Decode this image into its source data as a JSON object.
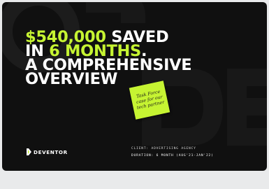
{
  "slide": {
    "headline": {
      "line1_accent": "$540,000",
      "line1_rest": " SAVED",
      "line2_prefix": "IN ",
      "line2_accent": "6 MONTHS",
      "line2_suffix": ".",
      "line3": "A COMPREHENSIVE",
      "line4": "OVERVIEW"
    },
    "sticky_note": "Task Force\ncase for our\ntech partner",
    "logo": {
      "wordmark": "DEVENTOR",
      "icon": "deventor-logo-icon"
    },
    "client": "CLIENT: ADVERTISING AGENCY",
    "duration": "DURATION: 6 MONTH (AUG'21-JAN'22)",
    "colors": {
      "background": "#101010",
      "accent": "#c6f432",
      "text": "#ffffff"
    }
  }
}
